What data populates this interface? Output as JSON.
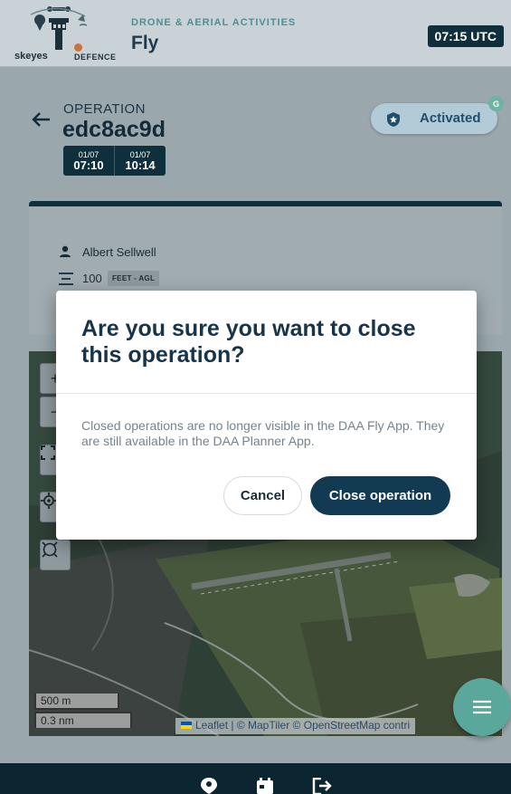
{
  "header": {
    "logo_brand": "skeyes",
    "logo_partner": "DEFENCE",
    "subtitle": "DRONE & AERIAL ACTIVITIES",
    "title": "Fly",
    "clock": "07:15 UTC"
  },
  "operation": {
    "label": "OPERATION",
    "id": "edc8ac9d",
    "start_date": "01/07",
    "start_time": "07:10",
    "end_date": "01/07",
    "end_time": "10:14",
    "status": "Activated",
    "status_badge": "G",
    "pilot": "Albert Sellwell",
    "altitude": "100",
    "altitude_unit": "FEET - AGL"
  },
  "map": {
    "scale_metric": "500 m",
    "scale_nautical": "0.3 nm",
    "attribution": "Leaflet | © MapTiler © OpenStreetMap contri",
    "controls": [
      "zoom-in-icon",
      "zoom-out-icon",
      "fullscreen-icon",
      "locate-icon",
      "draw-circle-icon"
    ]
  },
  "dialog": {
    "title": "Are you sure you want to close this operation?",
    "body": "Closed operations are no longer visible in the DAA Fly App. They are still available in the DAA Planner App.",
    "cancel_label": "Cancel",
    "confirm_label": "Close operation"
  },
  "bottom_nav": {
    "items": [
      "location-pin-icon",
      "calendar-icon",
      "logout-icon"
    ]
  },
  "colors": {
    "primary": "#123a52",
    "accent": "#5aa79c",
    "status_bg": "#b3cbd6"
  }
}
